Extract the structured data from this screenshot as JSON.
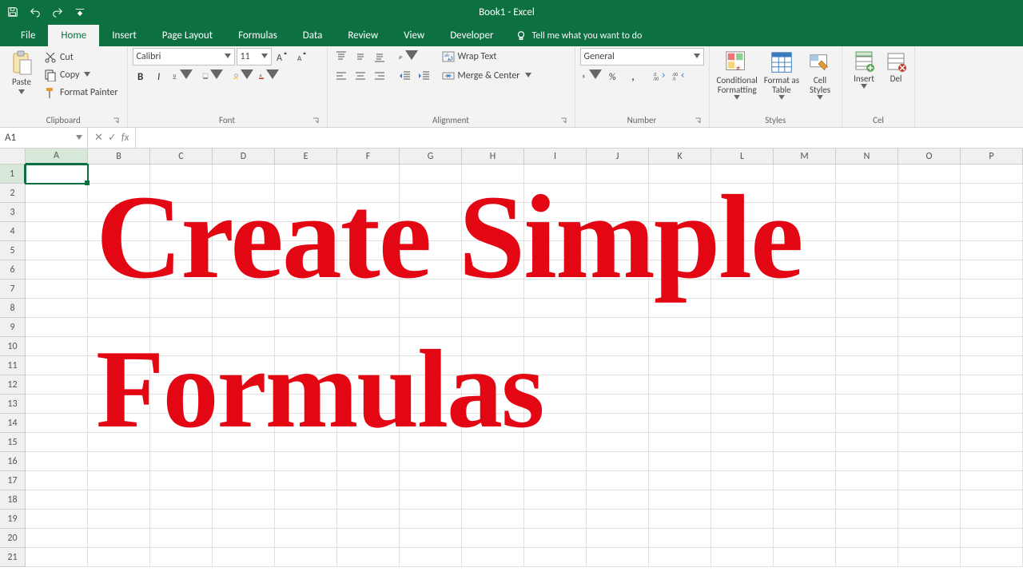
{
  "title_bar": {
    "title": "Book1 - Excel"
  },
  "tabs": {
    "file": "File",
    "home": "Home",
    "insert": "Insert",
    "page_layout": "Page Layout",
    "formulas": "Formulas",
    "data": "Data",
    "review": "Review",
    "view": "View",
    "developer": "Developer",
    "tellme": "Tell me what you want to do"
  },
  "ribbon": {
    "clipboard": {
      "label": "Clipboard",
      "paste": "Paste",
      "cut": "Cut",
      "copy": "Copy",
      "format_painter": "Format Painter"
    },
    "font": {
      "label": "Font",
      "name": "Calibri",
      "size": "11"
    },
    "alignment": {
      "label": "Alignment",
      "wrap": "Wrap Text",
      "merge": "Merge & Center"
    },
    "number": {
      "label": "Number",
      "format": "General"
    },
    "styles": {
      "label": "Styles",
      "conditional": "Conditional\nFormatting",
      "format_table": "Format as\nTable",
      "cell_styles": "Cell\nStyles"
    },
    "cells": {
      "label": "Cel",
      "insert": "Insert",
      "delete": "Del"
    }
  },
  "formula_bar": {
    "name": "A1",
    "fx": "fx",
    "value": ""
  },
  "grid": {
    "columns": [
      "A",
      "B",
      "C",
      "D",
      "E",
      "F",
      "G",
      "H",
      "I",
      "J",
      "K",
      "L",
      "M",
      "N",
      "O",
      "P"
    ],
    "rows": [
      "1",
      "2",
      "3",
      "4",
      "5",
      "6",
      "7",
      "8",
      "9",
      "10",
      "11",
      "12",
      "13",
      "14",
      "15",
      "16",
      "17",
      "18",
      "19",
      "20",
      "21"
    ],
    "active": "A1"
  },
  "overlay": {
    "l1": "Create Simple",
    "l2": "Formulas"
  }
}
